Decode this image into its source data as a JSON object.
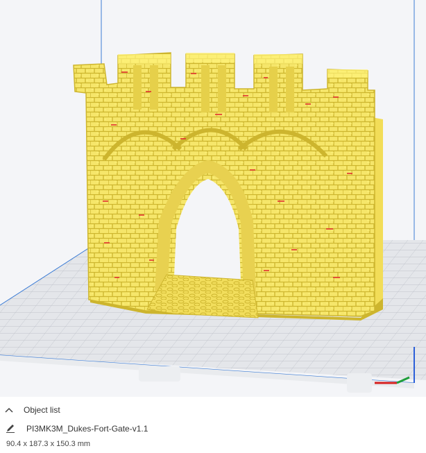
{
  "viewport": {
    "background": "#f4f5f8",
    "build_plate_color": "#dfe1e6",
    "grid_color": "#b9bdc6",
    "model_color": "#f6e66a",
    "model_highlight": "#fff27a",
    "model_shadow": "#cdb52e",
    "overhang_color": "#e23030",
    "axis_x_color": "#d62020",
    "axis_y_color": "#1f9e3b",
    "axis_z_color": "#2b5fd9",
    "volume_edge_color": "#3a7bd5"
  },
  "object_list": {
    "toggle_label": "Object list",
    "toggle_icon": "chevron-up-icon",
    "edit_icon": "pencil-icon",
    "object_name": "PI3MK3M_Dukes-Fort-Gate-v1.1",
    "dimensions": "90.4 x 187.3 x 150.3 mm"
  }
}
